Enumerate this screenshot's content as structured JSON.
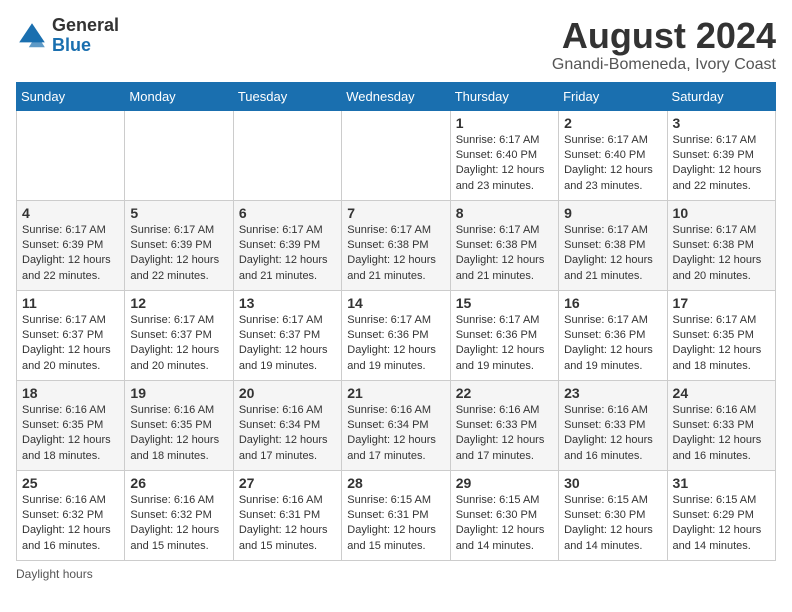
{
  "header": {
    "logo_general": "General",
    "logo_blue": "Blue",
    "month_title": "August 2024",
    "location": "Gnandi-Bomeneda, Ivory Coast"
  },
  "days_of_week": [
    "Sunday",
    "Monday",
    "Tuesday",
    "Wednesday",
    "Thursday",
    "Friday",
    "Saturday"
  ],
  "weeks": [
    [
      {
        "day": "",
        "info": ""
      },
      {
        "day": "",
        "info": ""
      },
      {
        "day": "",
        "info": ""
      },
      {
        "day": "",
        "info": ""
      },
      {
        "day": "1",
        "info": "Sunrise: 6:17 AM\nSunset: 6:40 PM\nDaylight: 12 hours and 23 minutes."
      },
      {
        "day": "2",
        "info": "Sunrise: 6:17 AM\nSunset: 6:40 PM\nDaylight: 12 hours and 23 minutes."
      },
      {
        "day": "3",
        "info": "Sunrise: 6:17 AM\nSunset: 6:39 PM\nDaylight: 12 hours and 22 minutes."
      }
    ],
    [
      {
        "day": "4",
        "info": "Sunrise: 6:17 AM\nSunset: 6:39 PM\nDaylight: 12 hours and 22 minutes."
      },
      {
        "day": "5",
        "info": "Sunrise: 6:17 AM\nSunset: 6:39 PM\nDaylight: 12 hours and 22 minutes."
      },
      {
        "day": "6",
        "info": "Sunrise: 6:17 AM\nSunset: 6:39 PM\nDaylight: 12 hours and 21 minutes."
      },
      {
        "day": "7",
        "info": "Sunrise: 6:17 AM\nSunset: 6:38 PM\nDaylight: 12 hours and 21 minutes."
      },
      {
        "day": "8",
        "info": "Sunrise: 6:17 AM\nSunset: 6:38 PM\nDaylight: 12 hours and 21 minutes."
      },
      {
        "day": "9",
        "info": "Sunrise: 6:17 AM\nSunset: 6:38 PM\nDaylight: 12 hours and 21 minutes."
      },
      {
        "day": "10",
        "info": "Sunrise: 6:17 AM\nSunset: 6:38 PM\nDaylight: 12 hours and 20 minutes."
      }
    ],
    [
      {
        "day": "11",
        "info": "Sunrise: 6:17 AM\nSunset: 6:37 PM\nDaylight: 12 hours and 20 minutes."
      },
      {
        "day": "12",
        "info": "Sunrise: 6:17 AM\nSunset: 6:37 PM\nDaylight: 12 hours and 20 minutes."
      },
      {
        "day": "13",
        "info": "Sunrise: 6:17 AM\nSunset: 6:37 PM\nDaylight: 12 hours and 19 minutes."
      },
      {
        "day": "14",
        "info": "Sunrise: 6:17 AM\nSunset: 6:36 PM\nDaylight: 12 hours and 19 minutes."
      },
      {
        "day": "15",
        "info": "Sunrise: 6:17 AM\nSunset: 6:36 PM\nDaylight: 12 hours and 19 minutes."
      },
      {
        "day": "16",
        "info": "Sunrise: 6:17 AM\nSunset: 6:36 PM\nDaylight: 12 hours and 19 minutes."
      },
      {
        "day": "17",
        "info": "Sunrise: 6:17 AM\nSunset: 6:35 PM\nDaylight: 12 hours and 18 minutes."
      }
    ],
    [
      {
        "day": "18",
        "info": "Sunrise: 6:16 AM\nSunset: 6:35 PM\nDaylight: 12 hours and 18 minutes."
      },
      {
        "day": "19",
        "info": "Sunrise: 6:16 AM\nSunset: 6:35 PM\nDaylight: 12 hours and 18 minutes."
      },
      {
        "day": "20",
        "info": "Sunrise: 6:16 AM\nSunset: 6:34 PM\nDaylight: 12 hours and 17 minutes."
      },
      {
        "day": "21",
        "info": "Sunrise: 6:16 AM\nSunset: 6:34 PM\nDaylight: 12 hours and 17 minutes."
      },
      {
        "day": "22",
        "info": "Sunrise: 6:16 AM\nSunset: 6:33 PM\nDaylight: 12 hours and 17 minutes."
      },
      {
        "day": "23",
        "info": "Sunrise: 6:16 AM\nSunset: 6:33 PM\nDaylight: 12 hours and 16 minutes."
      },
      {
        "day": "24",
        "info": "Sunrise: 6:16 AM\nSunset: 6:33 PM\nDaylight: 12 hours and 16 minutes."
      }
    ],
    [
      {
        "day": "25",
        "info": "Sunrise: 6:16 AM\nSunset: 6:32 PM\nDaylight: 12 hours and 16 minutes."
      },
      {
        "day": "26",
        "info": "Sunrise: 6:16 AM\nSunset: 6:32 PM\nDaylight: 12 hours and 15 minutes."
      },
      {
        "day": "27",
        "info": "Sunrise: 6:16 AM\nSunset: 6:31 PM\nDaylight: 12 hours and 15 minutes."
      },
      {
        "day": "28",
        "info": "Sunrise: 6:15 AM\nSunset: 6:31 PM\nDaylight: 12 hours and 15 minutes."
      },
      {
        "day": "29",
        "info": "Sunrise: 6:15 AM\nSunset: 6:30 PM\nDaylight: 12 hours and 14 minutes."
      },
      {
        "day": "30",
        "info": "Sunrise: 6:15 AM\nSunset: 6:30 PM\nDaylight: 12 hours and 14 minutes."
      },
      {
        "day": "31",
        "info": "Sunrise: 6:15 AM\nSunset: 6:29 PM\nDaylight: 12 hours and 14 minutes."
      }
    ]
  ],
  "footer": {
    "note": "Daylight hours"
  }
}
